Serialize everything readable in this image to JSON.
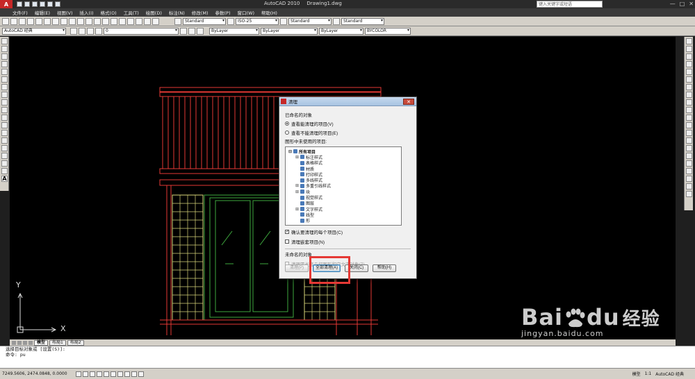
{
  "titlebar": {
    "app_letter": "A",
    "app_title": "AutoCAD 2010",
    "document": "Drawing1.dwg",
    "search_placeholder": "键入关键字或短语",
    "win_min": "—",
    "win_max": "□",
    "win_close": "✕"
  },
  "menu": {
    "items": [
      "文件(F)",
      "编辑(E)",
      "视图(V)",
      "插入(I)",
      "格式(O)",
      "工具(T)",
      "绘图(D)",
      "标注(N)",
      "修改(M)",
      "参数(P)",
      "窗口(W)",
      "帮助(H)"
    ]
  },
  "toolbar1": {
    "text_style": "Standard",
    "dim_style": "ISO-25",
    "table_style": "Standard",
    "mleader_style": "Standard"
  },
  "toolbar2": {
    "workspace": "AutoCAD 经典",
    "layer": "0",
    "color": "ByLayer",
    "linetype": "ByLayer",
    "lineweight": "ByLayer",
    "plotstyle": "BYCOLOR"
  },
  "ucs": {
    "y": "Y",
    "x": "X"
  },
  "tabs": {
    "model": "模型",
    "layout1": "布局1",
    "layout2": "布局2"
  },
  "command": {
    "line1": "选择目标对象或 [设置(S)]:",
    "line2": "命令: pu"
  },
  "status": {
    "coords": "7249.5606, 2474.0848, 0.0000",
    "model": "模型",
    "scale": "1:1",
    "workspace": "AutoCAD 经典"
  },
  "dialog": {
    "title": "清理",
    "close": "✕",
    "named_objects": "已命名的对象",
    "radio_can_purge": "查看能清理的项目(V)",
    "radio_cannot_purge": "查看不能清理的项目(E)",
    "tree_label": "图形中未使用的项目:",
    "tree_items": [
      {
        "label": "所有项目",
        "expander": "⊟"
      },
      {
        "label": "标注样式",
        "expander": "⊞"
      },
      {
        "label": "表格样式",
        "expander": ""
      },
      {
        "label": "材质",
        "expander": ""
      },
      {
        "label": "打印样式",
        "expander": ""
      },
      {
        "label": "多线样式",
        "expander": ""
      },
      {
        "label": "多重引线样式",
        "expander": "⊞"
      },
      {
        "label": "块",
        "expander": "⊞"
      },
      {
        "label": "视觉样式",
        "expander": ""
      },
      {
        "label": "图层",
        "expander": ""
      },
      {
        "label": "文字样式",
        "expander": "⊞"
      },
      {
        "label": "线型",
        "expander": ""
      },
      {
        "label": "形",
        "expander": ""
      }
    ],
    "confirm_each": "确认要清理的每个项目(C)",
    "purge_nested": "清理嵌套项目(N)",
    "unnamed_objects": "未命名的对象",
    "purge_zero_len": "清理零长度几何图形和空文字对象(Z)",
    "btn_purge": "清理(P)",
    "btn_purge_all": "全部清理(A)",
    "btn_close": "关闭(C)",
    "btn_help": "帮助(H)"
  },
  "watermark": {
    "logo_left": "Bai",
    "logo_right": "du",
    "logo_suffix": "经验",
    "url": "jingyan.baidu.com"
  },
  "colors": {
    "drawing_red": "#e53935",
    "drawing_green": "#3ea83e",
    "drawing_yellow": "#d8d67a",
    "highlight": "#e53935"
  }
}
